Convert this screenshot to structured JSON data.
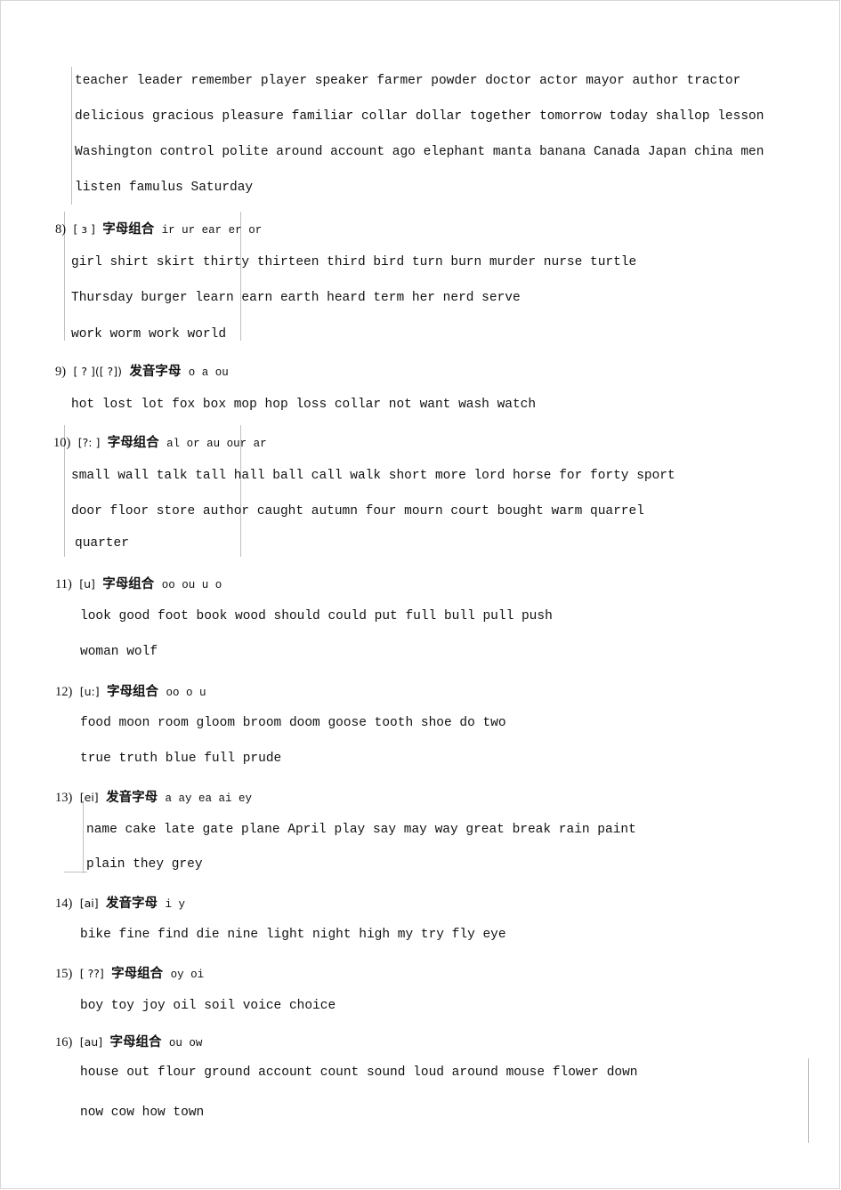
{
  "document": {
    "title": "English Phonics Letter-Combination Word Lists",
    "blocks": [
      {
        "id": "block-7-words",
        "header": null,
        "lines": [
          "teacher leader remember player speaker farmer powder doctor actor mayor author tractor",
          "delicious gracious pleasure familiar collar dollar together tomorrow today shallop lesson",
          "Washington control polite around account ago elephant manta banana Canada Japan china men",
          "listen famulus Saturday"
        ]
      },
      {
        "id": "block-8",
        "header": {
          "num": "8)",
          "phonetic": "[ ɜ ]",
          "cn": "字母组合",
          "letters": "ir   ur    ear er    or"
        },
        "lines": [
          "girl  shirt  skirt thirty  thirteen  third  bird  turn   burn   murder   nurse  turtle",
          "Thursday  burger  learn  earn  earth  heard  term  her nerd  serve",
          "work  worm  work  world"
        ]
      },
      {
        "id": "block-9",
        "header": {
          "num": "9)",
          "phonetic": "[ ? ]([ ?])",
          "cn": "发音字母",
          "letters": "o  a   ou"
        },
        "lines": [
          "hot lost  lot fox  box   mop   hop   loss  collar  not  want  wash   watch"
        ]
      },
      {
        "id": "block-10",
        "header": {
          "num": "10)",
          "phonetic": "[?: ]",
          "cn": "字母组合",
          "letters": "al   or    au  our   ar"
        },
        "lines": [
          "small  wall  talk  tall  hall  ball  call  walk  short   more lord  horse  for  forty  sport",
          "door  floor  store   author caught  autumn   four  mourn  court   bought  warm   quarrel",
          "quarter"
        ]
      },
      {
        "id": "block-11",
        "header": {
          "num": "11)",
          "phonetic": "[u]",
          "cn": "字母组合",
          "letters": "oo     ou    u   o"
        },
        "lines": [
          "look   good   foot  book  wood   should   could put  full    bull   pull  push",
          "woman    wolf"
        ]
      },
      {
        "id": "block-12",
        "header": {
          "num": "12)",
          "phonetic": "[u:]",
          "cn": "字母组合",
          "letters": "oo      o   u"
        },
        "lines": [
          "food  moon   room  gloom   broom  doom  goose  tooth  shoe     do  two",
          "true  truth  blue   full   prude"
        ]
      },
      {
        "id": "block-13",
        "header": {
          "num": "13)",
          "phonetic": "[ei]",
          "cn": "发音字母",
          "letters": "a   ay    ea   ai  ey"
        },
        "lines": [
          "name   cake  late  gate plane   April   play say   may  way   great  break  rain  paint",
          "plain   they   grey"
        ]
      },
      {
        "id": "block-14",
        "header": {
          "num": "14)",
          "phonetic": "[ai]",
          "cn": "发音字母",
          "letters": "i    y"
        },
        "lines": [
          "bike  fine  find   die  nine   light  night   high    my  try   fly   eye"
        ]
      },
      {
        "id": "block-15",
        "header": {
          "num": "15)",
          "phonetic": "[ ??]",
          "cn": "字母组合",
          "letters": "oy     oi"
        },
        "lines": [
          "boy   toy   joy  oil   soil voice   choice"
        ]
      },
      {
        "id": "block-16",
        "header": {
          "num": "16)",
          "phonetic": "[au]",
          "cn": "字母组合",
          "letters": "ou   ow"
        },
        "lines": [
          "house out  flour ground account count sound loud around mouse flower down",
          "now cow how town"
        ]
      }
    ]
  }
}
